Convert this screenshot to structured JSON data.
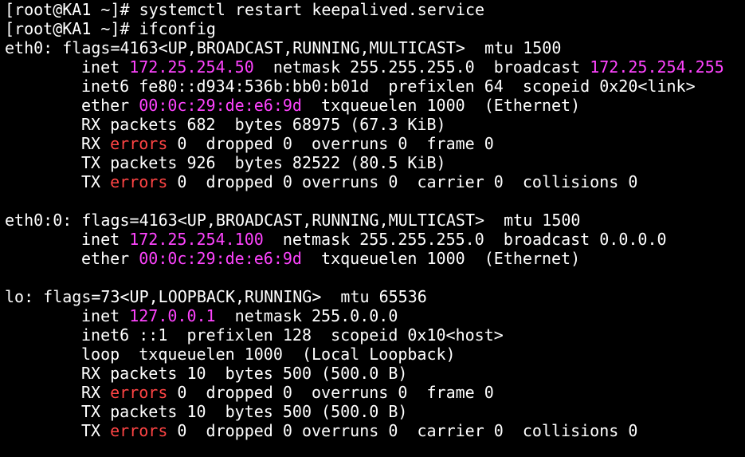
{
  "colors": {
    "background": "#000000",
    "text": "#ffffff",
    "address": "#ff44ff",
    "errors": "#ff4444"
  },
  "lines": [
    {
      "segs": [
        {
          "t": "[root@KA1 ~]# systemctl restart keepalived.service"
        }
      ]
    },
    {
      "segs": [
        {
          "t": "[root@KA1 ~]# ifconfig"
        }
      ]
    },
    {
      "segs": [
        {
          "t": "eth0: flags=4163<UP,BROADCAST,RUNNING,MULTICAST>  mtu 1500"
        }
      ]
    },
    {
      "indent": true,
      "segs": [
        {
          "t": "inet "
        },
        {
          "t": "172.25.254.50",
          "c": "mag"
        },
        {
          "t": "  netmask 255.255.255.0  broadcast "
        },
        {
          "t": "172.25.254.255",
          "c": "mag"
        }
      ]
    },
    {
      "indent": true,
      "segs": [
        {
          "t": "inet6 fe80::d934:536b:bb0:b01d  prefixlen 64  scopeid 0x20<link>"
        }
      ]
    },
    {
      "indent": true,
      "segs": [
        {
          "t": "ether "
        },
        {
          "t": "00:0c:29:de:e6:9d",
          "c": "mag"
        },
        {
          "t": "  txqueuelen 1000  (Ethernet)"
        }
      ]
    },
    {
      "indent": true,
      "segs": [
        {
          "t": "RX packets 682  bytes 68975 (67.3 KiB)"
        }
      ]
    },
    {
      "indent": true,
      "segs": [
        {
          "t": "RX "
        },
        {
          "t": "errors",
          "c": "red"
        },
        {
          "t": " 0  dropped 0  overruns 0  frame 0"
        }
      ]
    },
    {
      "indent": true,
      "segs": [
        {
          "t": "TX packets 926  bytes 82522 (80.5 KiB)"
        }
      ]
    },
    {
      "indent": true,
      "segs": [
        {
          "t": "TX "
        },
        {
          "t": "errors",
          "c": "red"
        },
        {
          "t": " 0  dropped 0 overruns 0  carrier 0  collisions 0"
        }
      ]
    },
    {
      "segs": []
    },
    {
      "segs": [
        {
          "t": "eth0:0: flags=4163<UP,BROADCAST,RUNNING,MULTICAST>  mtu 1500"
        }
      ]
    },
    {
      "indent": true,
      "segs": [
        {
          "t": "inet "
        },
        {
          "t": "172.25.254.100",
          "c": "mag"
        },
        {
          "t": "  netmask 255.255.255.0  broadcast 0.0.0.0"
        }
      ]
    },
    {
      "indent": true,
      "segs": [
        {
          "t": "ether "
        },
        {
          "t": "00:0c:29:de:e6:9d",
          "c": "mag"
        },
        {
          "t": "  txqueuelen 1000  (Ethernet)"
        }
      ]
    },
    {
      "segs": []
    },
    {
      "segs": [
        {
          "t": "lo: flags=73<UP,LOOPBACK,RUNNING>  mtu 65536"
        }
      ]
    },
    {
      "indent": true,
      "segs": [
        {
          "t": "inet "
        },
        {
          "t": "127.0.0.1",
          "c": "mag"
        },
        {
          "t": "  netmask 255.0.0.0"
        }
      ]
    },
    {
      "indent": true,
      "segs": [
        {
          "t": "inet6 ::1  prefixlen 128  scopeid 0x10<host>"
        }
      ]
    },
    {
      "indent": true,
      "segs": [
        {
          "t": "loop  txqueuelen 1000  (Local Loopback)"
        }
      ]
    },
    {
      "indent": true,
      "segs": [
        {
          "t": "RX packets 10  bytes 500 (500.0 B)"
        }
      ]
    },
    {
      "indent": true,
      "segs": [
        {
          "t": "RX "
        },
        {
          "t": "errors",
          "c": "red"
        },
        {
          "t": " 0  dropped 0  overruns 0  frame 0"
        }
      ]
    },
    {
      "indent": true,
      "segs": [
        {
          "t": "TX packets 10  bytes 500 (500.0 B)"
        }
      ]
    },
    {
      "indent": true,
      "segs": [
        {
          "t": "TX "
        },
        {
          "t": "errors",
          "c": "red"
        },
        {
          "t": " 0  dropped 0 overruns 0  carrier 0  collisions 0"
        }
      ]
    }
  ]
}
